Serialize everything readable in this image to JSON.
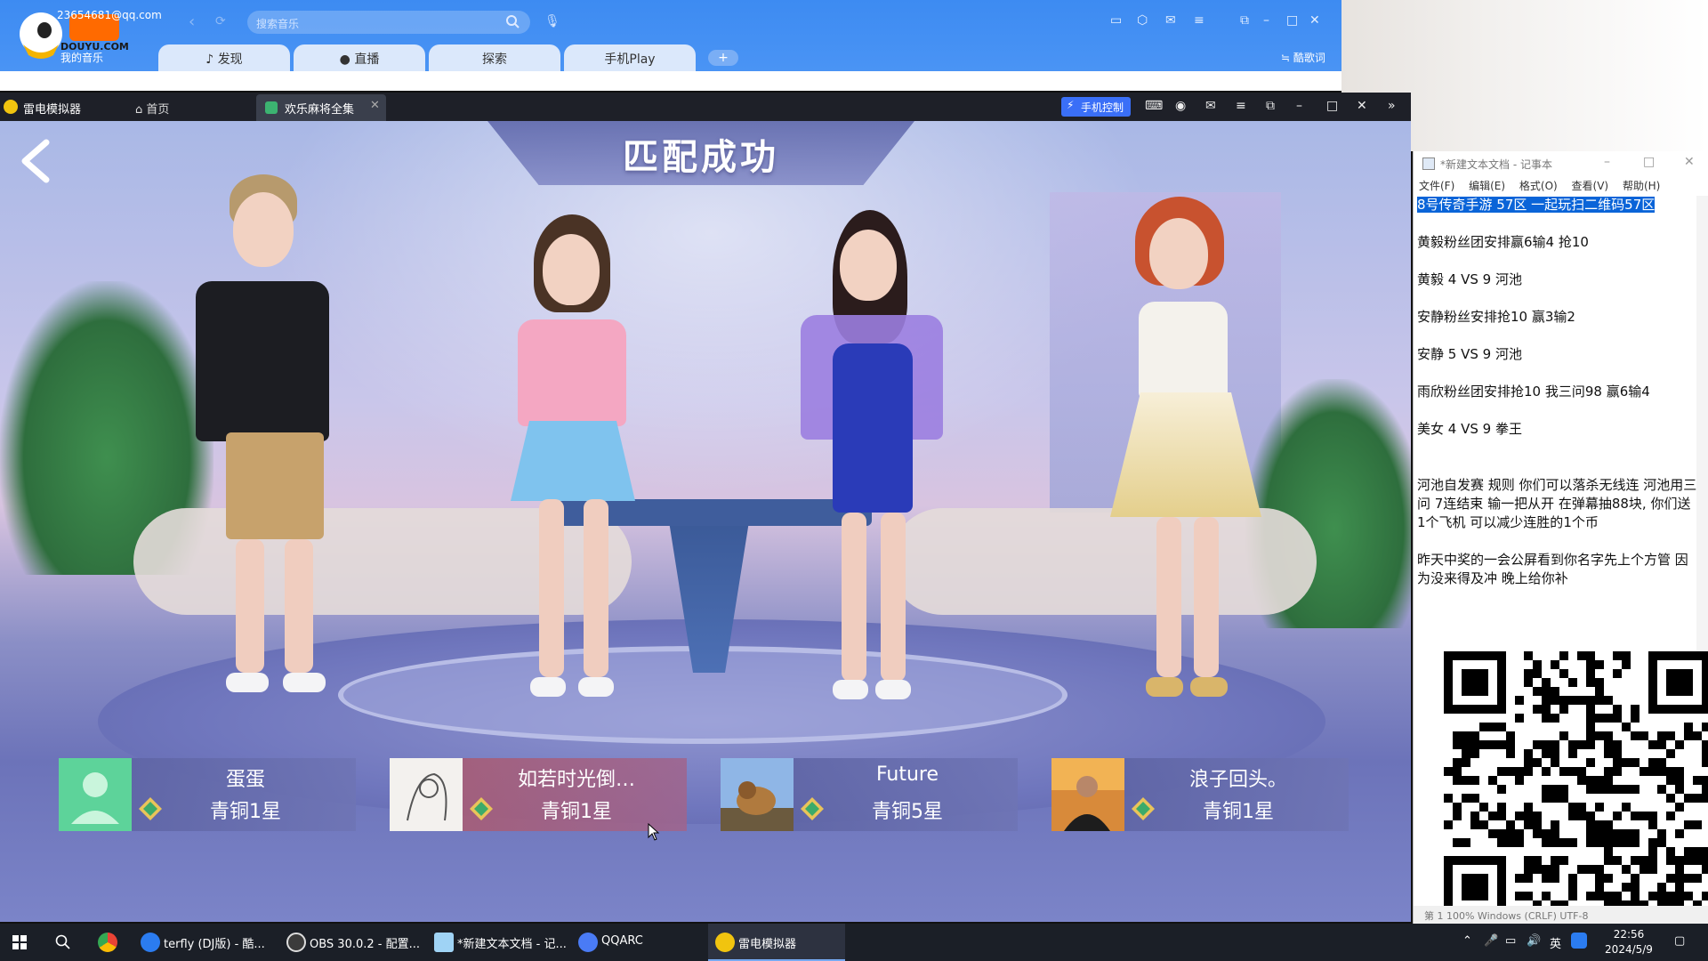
{
  "music": {
    "user": "23654681@qq.com",
    "my_music": "我的音乐",
    "logo_text": "DOUYU.COM",
    "search_placeholder": "搜索音乐",
    "tabs": [
      {
        "label": "发现"
      },
      {
        "label": "直播"
      },
      {
        "label": "探索"
      },
      {
        "label": "手机Play"
      }
    ],
    "add_tab": "+",
    "lyric_label": "酷歌词"
  },
  "emulator": {
    "title": "雷电模拟器",
    "home_label": "首页",
    "tab_label": "欢乐麻将全集",
    "phone_control": "手机控制"
  },
  "game": {
    "title": "匹配成功",
    "players": [
      {
        "name": "蛋蛋",
        "rank": "青铜1星"
      },
      {
        "name": "如若时光倒…",
        "rank": "青铜1星"
      },
      {
        "name": "Future",
        "rank": "青铜5星"
      },
      {
        "name": "浪子回头。",
        "rank": "青铜1星"
      }
    ]
  },
  "notepad": {
    "title": "*新建文本文档 - 记事本",
    "menu": [
      "文件(F)",
      "编辑(E)",
      "格式(O)",
      "查看(V)",
      "帮助(H)"
    ],
    "lines": [
      "8号传奇手游 57区 一起玩扫二维码57区",
      "",
      "黄毅粉丝团安排赢6输4 抢10",
      "",
      "黄毅 4 VS 9 河池",
      "",
      "安静粉丝安排抢10 赢3输2",
      "",
      "安静 5 VS 9 河池",
      "",
      "雨欣粉丝团安排抢10 我三问98 赢6输4",
      "",
      "美女 4 VS 9 拳王",
      "",
      "",
      "河池自发赛 规则 你们可以落杀无线连 河池用三问 7连结束 输一把从开 在弹幕抽88块, 你们送1个飞机 可以减少连胜的1个币",
      "",
      "昨天中奖的一会公屏看到你名字先上个方管 因为没来得及冲 晚上给你补"
    ],
    "status": "第 1    100%    Windows (CRLF)    UTF-8"
  },
  "taskbar": {
    "items": [
      {
        "label": "terfly (DJ版) - 酷..."
      },
      {
        "label": "OBS 30.0.2 - 配置..."
      },
      {
        "label": "*新建文本文档 - 记..."
      },
      {
        "label": "QQARC"
      },
      {
        "label": "雷电模拟器"
      }
    ],
    "ime": "英",
    "time": "22:56",
    "date": "2024/5/9"
  },
  "colors": {
    "music_bar": "#3d8bf2",
    "emulator_bar": "#1e2028",
    "phone_control": "#3a6ff7",
    "selection": "#0a64d8",
    "taskbar": "#1b1f27"
  }
}
